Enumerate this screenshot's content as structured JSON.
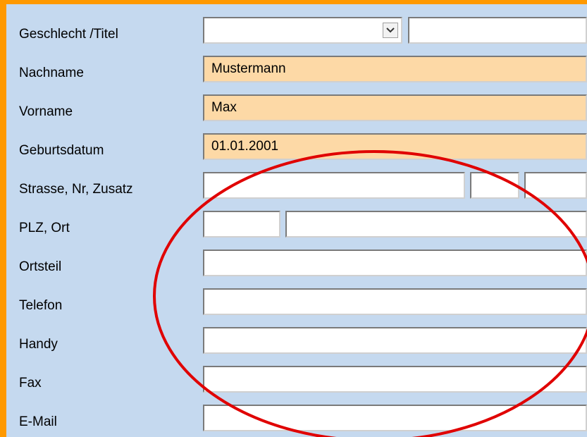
{
  "form": {
    "salutation": {
      "label": "Geschlecht /Titel",
      "gender_value": "",
      "title_value": ""
    },
    "last_name": {
      "label": "Nachname",
      "value": "Mustermann"
    },
    "first_name": {
      "label": "Vorname",
      "value": "Max"
    },
    "birth_date": {
      "label": "Geburtsdatum",
      "value": "01.01.2001"
    },
    "street": {
      "label": "Strasse, Nr, Zusatz",
      "street_value": "",
      "number_value": "",
      "suffix_value": ""
    },
    "city": {
      "label": "PLZ, Ort",
      "zip_value": "",
      "city_value": ""
    },
    "district": {
      "label": "Ortsteil",
      "value": ""
    },
    "phone": {
      "label": "Telefon",
      "value": ""
    },
    "mobile": {
      "label": "Handy",
      "value": ""
    },
    "fax": {
      "label": "Fax",
      "value": ""
    },
    "email": {
      "label": "E-Mail",
      "value": ""
    }
  },
  "colors": {
    "frame": "#ff9900",
    "background": "#c5d9ef",
    "filled_field": "#fdd9a6",
    "annotation": "#e00000"
  },
  "icons": {
    "dropdown": "chevron-down-icon"
  }
}
